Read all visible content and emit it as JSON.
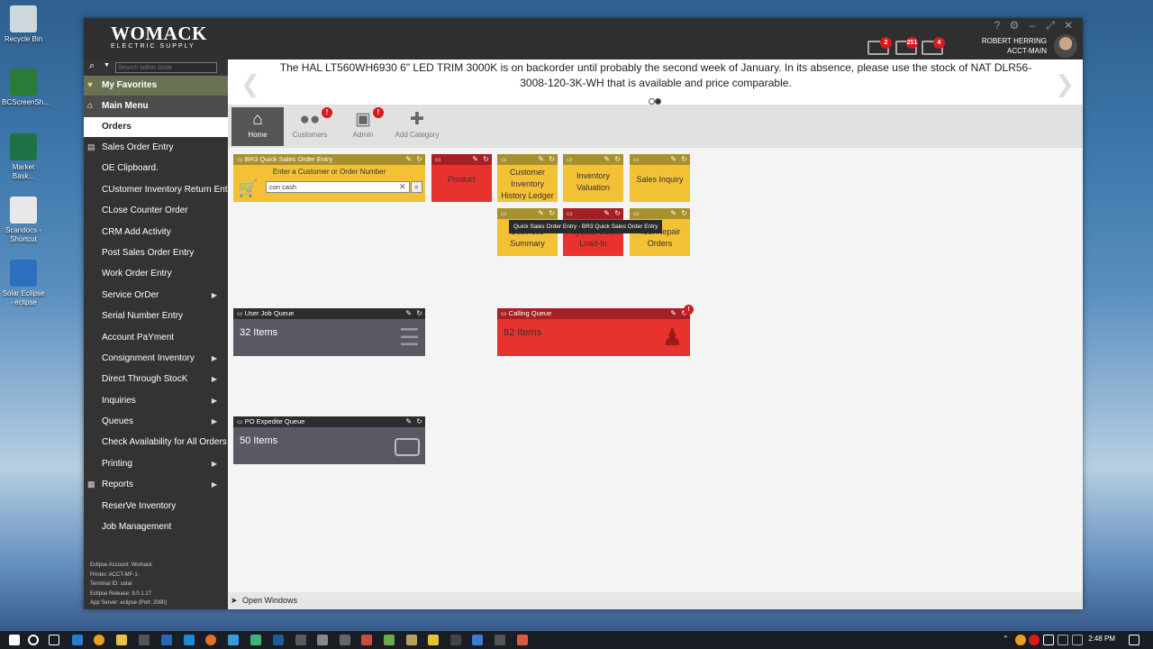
{
  "desktop": {
    "icons": [
      {
        "label": "Recycle Bin"
      },
      {
        "label": "BCScreenSh..."
      },
      {
        "label": "Market Bask..."
      },
      {
        "label": "Scandocs - Shortcut"
      },
      {
        "label": "Solar Eclipse - eclipse"
      }
    ]
  },
  "app": {
    "logo_main": "WOMACK",
    "logo_sub": "ELECTRIC SUPPLY",
    "window_controls": [
      "?",
      "⚙",
      "–",
      "⤢",
      "✕"
    ],
    "header_badges": [
      "2",
      "251",
      "4"
    ],
    "user_name": "ROBERT HERRING",
    "user_branch": "ACCT-MAIN"
  },
  "sidebar": {
    "search_placeholder": "Search within Solar",
    "favorites_label": "My Favorites",
    "main_menu_label": "Main Menu",
    "orders_label": "Orders",
    "items": [
      {
        "label": "Sales Order Entry"
      },
      {
        "label": "OE Clipboard."
      },
      {
        "label": "CUstomer Inventory Return Entry"
      },
      {
        "label": "CLose Counter Order"
      },
      {
        "label": "CRM Add Activity"
      },
      {
        "label": "Post Sales Order Entry"
      },
      {
        "label": "Work Order Entry"
      },
      {
        "label": "Service OrDer"
      },
      {
        "label": "Serial Number Entry"
      },
      {
        "label": "Account PaYment"
      },
      {
        "label": "Consignment Inventory"
      },
      {
        "label": "Direct Through StocK"
      },
      {
        "label": "Inquiries"
      },
      {
        "label": "Queues"
      },
      {
        "label": "Check Availability for All Orders"
      },
      {
        "label": "Printing"
      },
      {
        "label": "Reports"
      },
      {
        "label": "ReserVe Inventory"
      },
      {
        "label": "Job Management"
      }
    ],
    "sysinfo": [
      "Eclipse Account: Womack",
      "Printer: ACCT-MF-1-",
      "Terminal ID: solar",
      "Eclipse Release: 9.0.1.17",
      "App Server: eclipse (Port: 2080)"
    ]
  },
  "announcement": {
    "text": "The HAL LT560WH6930 6\" LED TRIM 3000K is on backorder until probably the second week of January. In its absence, please use the stock of NAT DLR56-3008-120-3K-WH that is available and price comparable."
  },
  "categories": [
    {
      "label": "Home"
    },
    {
      "label": "Customers"
    },
    {
      "label": "Admin"
    },
    {
      "label": "Add Category"
    }
  ],
  "category_badges": [
    "!",
    "!"
  ],
  "tiles": {
    "quick_order": {
      "title": "BR3 Quick Sales Order Entry",
      "prompt": "Enter a Customer or Order Number",
      "input_value": "con cash",
      "tooltip": "Quick Sales Order Entry - BR3 Quick Sales Order Entry"
    },
    "product": {
      "label": "Product"
    },
    "cust_inv_ledger": {
      "label": "Customer Inventory History Ledger"
    },
    "inv_valuation": {
      "label": "Inventory Valuation"
    },
    "sales_inquiry": {
      "label": "Sales Inquiry"
    },
    "business_summary": {
      "label": "Business Summary"
    },
    "physical_count": {
      "label": "Physical Count Load-In"
    },
    "tool_repair": {
      "label": "Tool Repair Orders"
    },
    "user_job_queue": {
      "title": "User Job Queue",
      "count": "32 Items"
    },
    "calling_queue": {
      "title": "Calling Queue",
      "count": "82 Items",
      "alert": "!"
    },
    "po_expedite_queue": {
      "title": "PO Expedite Queue",
      "count": "50 Items"
    }
  },
  "footer": {
    "open_windows": "Open Windows"
  },
  "taskbar": {
    "time": "2:48 PM"
  }
}
